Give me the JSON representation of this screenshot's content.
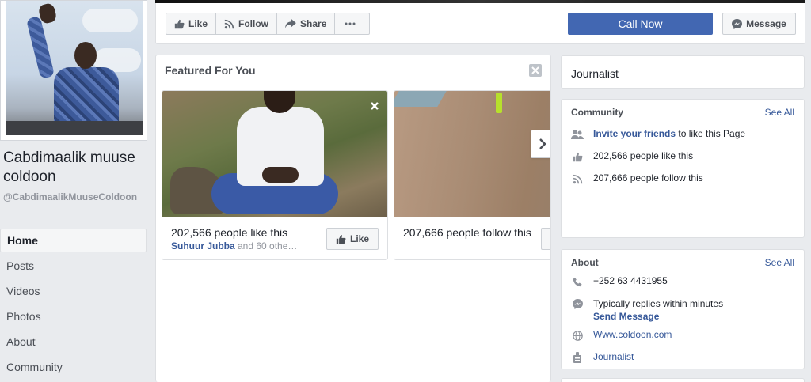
{
  "page": {
    "name": "Cabdimaalik muuse coldoon",
    "handle": "@CabdimaalikMuuseColdoon"
  },
  "nav": {
    "items": [
      {
        "label": "Home",
        "active": true
      },
      {
        "label": "Posts"
      },
      {
        "label": "Videos"
      },
      {
        "label": "Photos"
      },
      {
        "label": "About"
      },
      {
        "label": "Community"
      }
    ]
  },
  "actions": {
    "like": "Like",
    "follow": "Follow",
    "share": "Share",
    "call_now": "Call Now",
    "message": "Message"
  },
  "featured": {
    "title": "Featured For You",
    "cards": [
      {
        "caption": "202,566 people like this",
        "friend": "Suhuur Jubba",
        "others": " and 60 othe…",
        "button": "Like"
      },
      {
        "caption": "207,666 people follow this"
      }
    ]
  },
  "sidebar": {
    "category": "Journalist",
    "community": {
      "heading": "Community",
      "see_all": "See All",
      "invite_link": "Invite your friends",
      "invite_rest": " to like this Page",
      "likes": "202,566 people like this",
      "follows": "207,666 people follow this"
    },
    "about": {
      "heading": "About",
      "see_all": "See All",
      "phone": "+252 63 4431955",
      "replies": "Typically replies within minutes",
      "send_message": "Send Message",
      "website": "Www.coldoon.com",
      "category": "Journalist"
    }
  },
  "colors": {
    "brand_blue": "#4267b2",
    "link_blue": "#365899",
    "background": "#e9ebee"
  }
}
